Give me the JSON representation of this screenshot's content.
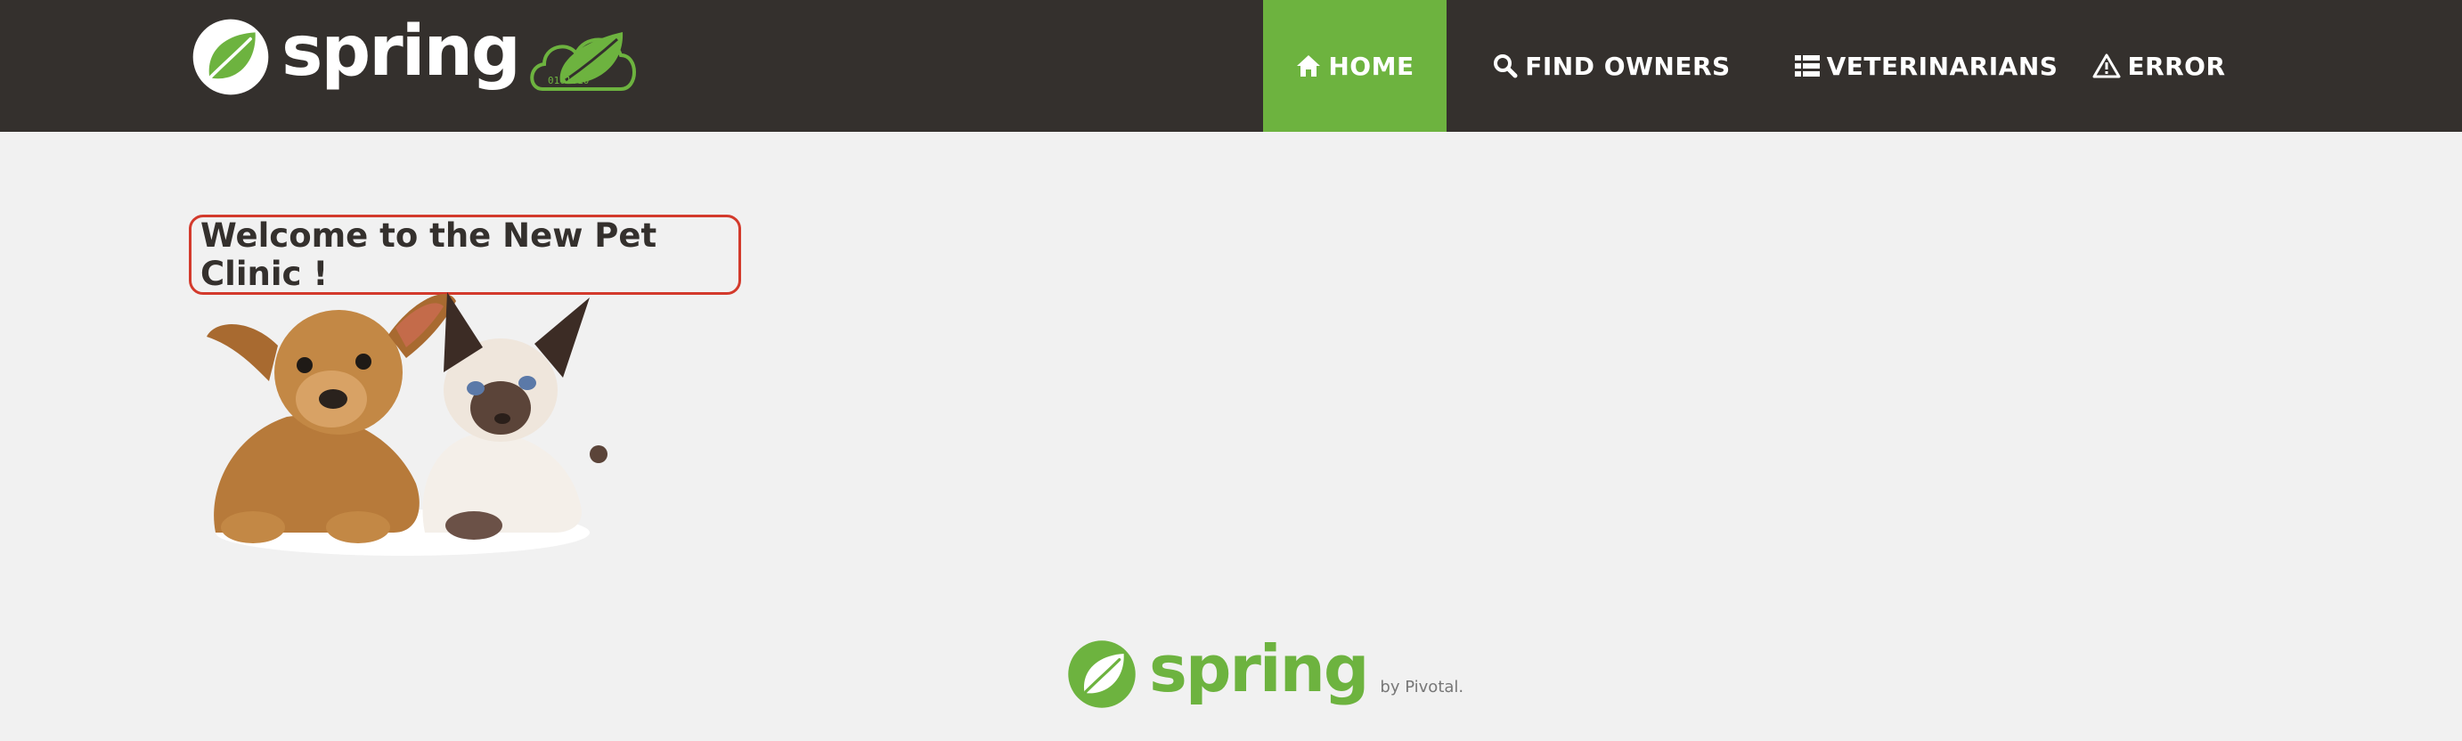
{
  "navbar": {
    "brand": {
      "word": "spring",
      "cloud_digits": "0101010"
    },
    "items": [
      {
        "label": "HOME",
        "icon": "home-icon",
        "active": true
      },
      {
        "label": "FIND OWNERS",
        "icon": "search-icon",
        "active": false
      },
      {
        "label": "VETERINARIANS",
        "icon": "list-icon",
        "active": false
      },
      {
        "label": "ERROR",
        "icon": "warning-icon",
        "active": false
      }
    ]
  },
  "main": {
    "welcome": "Welcome to the New Pet Clinic !",
    "image": "puppy and kitten photo"
  },
  "footer": {
    "word": "spring",
    "by": "by Pivotal."
  },
  "colors": {
    "navbar_bg": "#34302d",
    "accent_green": "#6db33f",
    "page_bg": "#f1f1f1",
    "welcome_border": "#d33a2c"
  }
}
